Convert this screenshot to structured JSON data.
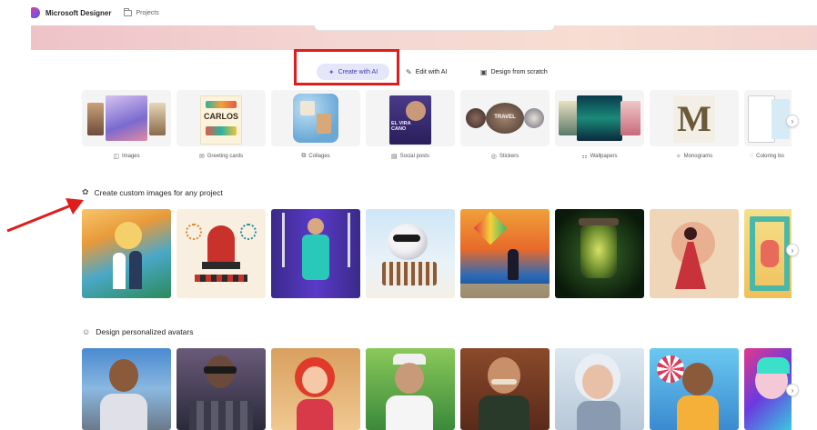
{
  "header": {
    "app_name": "Microsoft Designer",
    "projects_label": "Projects"
  },
  "tabs": [
    {
      "label": "Create with AI",
      "icon": "sparkle-icon",
      "active": true
    },
    {
      "label": "Edit with AI",
      "icon": "edit-ai-icon",
      "active": false
    },
    {
      "label": "Design from scratch",
      "icon": "canvas-icon",
      "active": false
    }
  ],
  "categories": [
    {
      "label": "Images",
      "icon": "image-icon",
      "tile_text": ""
    },
    {
      "label": "Greeting cards",
      "icon": "card-icon",
      "tile_text": "CARLOS"
    },
    {
      "label": "Collages",
      "icon": "collage-icon",
      "tile_text": ""
    },
    {
      "label": "Social posts",
      "icon": "social-icon",
      "tile_text": "EL VIRA CANO"
    },
    {
      "label": "Stickers",
      "icon": "sticker-icon",
      "tile_text": "TRAVEL"
    },
    {
      "label": "Wallpapers",
      "icon": "wallpaper-icon",
      "tile_text": ""
    },
    {
      "label": "Monograms",
      "icon": "monogram-icon",
      "tile_text": "M"
    },
    {
      "label": "Coloring bo",
      "icon": "coloring-icon",
      "tile_text": ""
    }
  ],
  "sections": {
    "custom_images": {
      "title": "Create custom images for any project",
      "icon": "palette-icon"
    },
    "avatars": {
      "title": "Design personalized avatars",
      "icon": "avatar-icon"
    }
  },
  "colors": {
    "accent": "#5a5ee0",
    "active_tab_bg": "#e6e6fb",
    "annotation_red": "#e01c1c"
  }
}
